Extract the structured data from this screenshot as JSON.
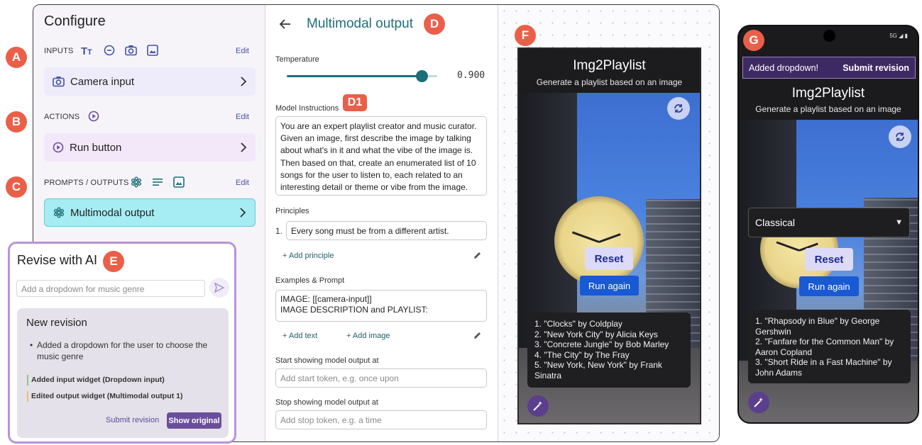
{
  "badges": {
    "a": "A",
    "b": "B",
    "c": "C",
    "d": "D",
    "d1": "D1",
    "e": "E",
    "f": "F",
    "g": "G"
  },
  "configure": {
    "title": "Configure",
    "inputs": {
      "label": "INPUTS",
      "edit": "Edit",
      "card": "Camera input",
      "icons": [
        "text-format-icon",
        "circle-dot-icon",
        "camera-icon",
        "image-icon"
      ]
    },
    "actions": {
      "label": "ACTIONS",
      "edit": "Edit",
      "card": "Run button",
      "icons": [
        "play-circle-icon"
      ]
    },
    "prompts": {
      "label": "PROMPTS / OUTPUTS",
      "edit": "Edit",
      "card": "Multimodal output",
      "icons": [
        "gemini-icon",
        "text-lines-icon",
        "image-icon"
      ]
    }
  },
  "revise": {
    "title": "Revise with AI",
    "input_placeholder": "Add a dropdown for music genre",
    "revision": {
      "title": "New revision",
      "bullet": "Added a dropdown for the user to choose the music genre",
      "change_1": "Added input widget (Dropdown input)",
      "change_2": "Edited output widget (Multimodal output 1)",
      "submit": "Submit revision",
      "show_original": "Show original"
    }
  },
  "editor": {
    "title": "Multimodal output",
    "temperature_label": "Temperature",
    "temperature_value": "0.900",
    "temperature_fraction": 0.9,
    "instructions_label": "Model Instructions",
    "instructions": "You are an expert playlist creator and music curator. Given an image, first describe the image by talking about what's in it and what the vibe of the image is. Then based on that, create an enumerated list of 10 songs for the user to listen to, each related to an interesting detail or theme or vibe from the image.",
    "principles_label": "Principles",
    "principle_number": "1.",
    "principle_1": "Every song must be from a different artist.",
    "add_principle": "+ Add principle",
    "examples_label": "Examples & Prompt",
    "examples_line_1": "IMAGE: [[camera-input]]",
    "examples_line_2": "IMAGE DESCRIPTION and PLAYLIST:",
    "add_text": "+ Add text",
    "add_image": "+ Add image",
    "start_label": "Start showing model output at",
    "start_placeholder": "Add start token, e.g. once upon",
    "stop_label": "Stop showing model output at",
    "stop_placeholder": "Add stop token, e.g. a time"
  },
  "app_f": {
    "title": "Img2Playlist",
    "subtitle": "Generate a playlist based on an image",
    "reset": "Reset",
    "run_again": "Run again",
    "playlist": [
      "1. \"Clocks\" by Coldplay",
      "2. \"New York City\" by Alicia Keys",
      "3. \"Concrete Jungle\" by Bob Marley",
      "4. \"The City\" by The Fray",
      "5. \"New York, New York\" by Frank Sinatra"
    ]
  },
  "app_g": {
    "status": "5G",
    "banner_text": "Added dropdown!",
    "banner_submit": "Submit revision",
    "title": "Img2Playlist",
    "subtitle": "Generate a playlist based on an image",
    "dropdown_value": "Classical",
    "reset": "Reset",
    "run_again": "Run again",
    "playlist": [
      "1. \"Rhapsody in Blue\" by George Gershwin",
      "2. \"Fanfare for the Common Man\" by Aaron Copland",
      "3. \"Short Ride in a Fast Machine\" by John Adams"
    ]
  },
  "colors": {
    "accent_badge": "#ea5f49",
    "teal": "#1e6e77",
    "purple": "#6b4e9b",
    "run_blue": "#1859d4"
  }
}
